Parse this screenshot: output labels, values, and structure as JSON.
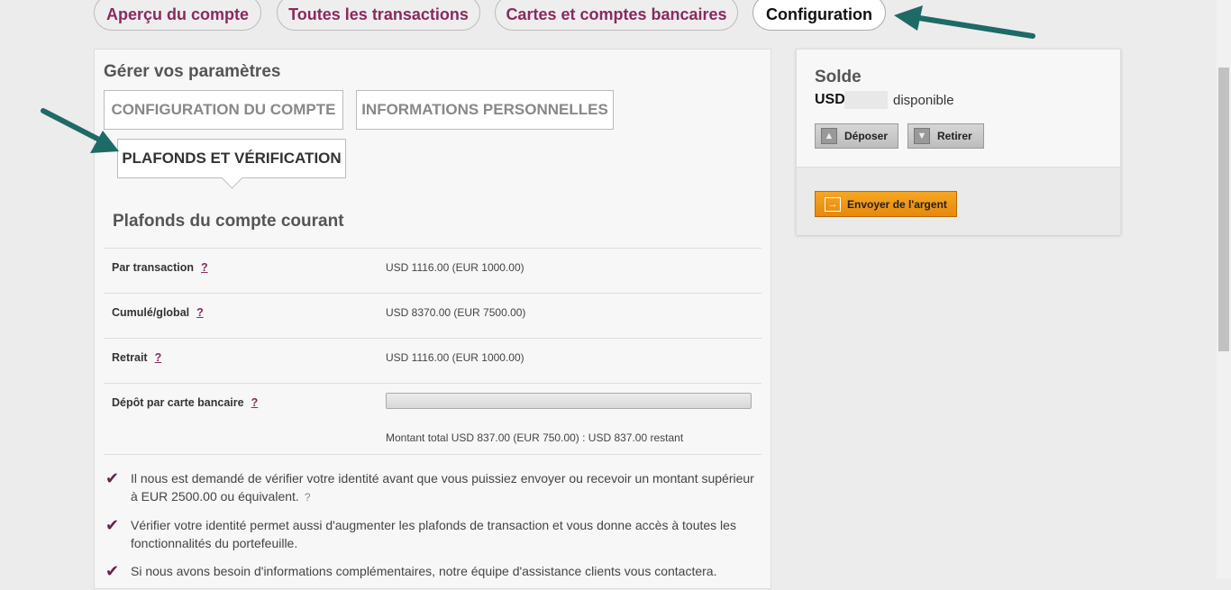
{
  "nav": {
    "tabs": [
      {
        "label": "Aperçu du compte"
      },
      {
        "label": "Toutes les transactions"
      },
      {
        "label": "Cartes et comptes bancaires"
      },
      {
        "label": "Configuration"
      }
    ]
  },
  "settings": {
    "title": "Gérer vos paramètres",
    "subtabs": [
      {
        "label": "CONFIGURATION DU COMPTE"
      },
      {
        "label": "INFORMATIONS PERSONNELLES"
      },
      {
        "label": "PLAFONDS ET VÉRIFICATION"
      }
    ],
    "section_title": "Plafonds du compte courant",
    "limits": [
      {
        "label": "Par transaction",
        "help": "?",
        "value": "USD 1116.00 (EUR 1000.00)"
      },
      {
        "label": "Cumulé/global",
        "help": "?",
        "value": "USD 8370.00 (EUR 7500.00)"
      },
      {
        "label": "Retrait",
        "help": "?",
        "value": "USD 1116.00 (EUR 1000.00)"
      },
      {
        "label": "Dépôt par carte bancaire",
        "help": "?",
        "progress": 0,
        "note": "Montant total USD 837.00 (EUR 750.00) : USD 837.00 restant"
      }
    ],
    "notes": [
      {
        "text": "Il nous est demandé de vérifier votre identité avant que vous puissiez envoyer ou recevoir un montant supérieur à EUR 2500.00 ou équivalent.",
        "help": "?"
      },
      {
        "text": "Vérifier votre identité permet aussi d'augmenter les plafonds de transaction et vous donne accès à toutes les fonctionnalités du portefeuille."
      },
      {
        "text": "Si nous avons besoin d'informations complémentaires, notre équipe d'assistance clients vous contactera."
      }
    ]
  },
  "balance": {
    "title": "Solde",
    "currency": "USD",
    "available_label": "disponible",
    "deposit_label": "Déposer",
    "withdraw_label": "Retirer",
    "send_label": "Envoyer de l'argent"
  },
  "icons": {
    "deposit": "arrow-up-icon",
    "withdraw": "arrow-down-icon",
    "send": "send-arrow-icon",
    "check": "checkmark-icon"
  },
  "colors": {
    "brand": "#8a2a5e",
    "send_button": "#f29b17",
    "annotation_arrow": "#1d6a67"
  }
}
